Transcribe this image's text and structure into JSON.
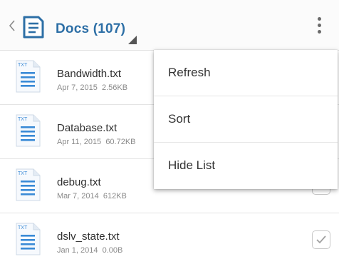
{
  "toolbar": {
    "title": "Docs (107)",
    "back_icon": "chevron-left-icon",
    "app_icon": "document-list-icon",
    "dropdown_icon": "dropdown-triangle-icon",
    "overflow_icon": "more-vertical-icon",
    "accent_color": "#2d6fa6"
  },
  "files": [
    {
      "badge": "TXT",
      "name": "Bandwidth.txt",
      "date": "Apr 7, 2015",
      "size": "2.56KB",
      "checked": false
    },
    {
      "badge": "TXT",
      "name": "Database.txt",
      "date": "Apr 11, 2015",
      "size": "60.72KB",
      "checked": false
    },
    {
      "badge": "TXT",
      "name": "debug.txt",
      "date": "Mar 7, 2014",
      "size": "612KB",
      "checked": false
    },
    {
      "badge": "TXT",
      "name": "dslv_state.txt",
      "date": "Jan 1, 2014",
      "size": "0.00B",
      "checked": true
    }
  ],
  "menu": {
    "items": [
      {
        "label": "Refresh"
      },
      {
        "label": "Sort"
      },
      {
        "label": "Hide List"
      }
    ]
  }
}
